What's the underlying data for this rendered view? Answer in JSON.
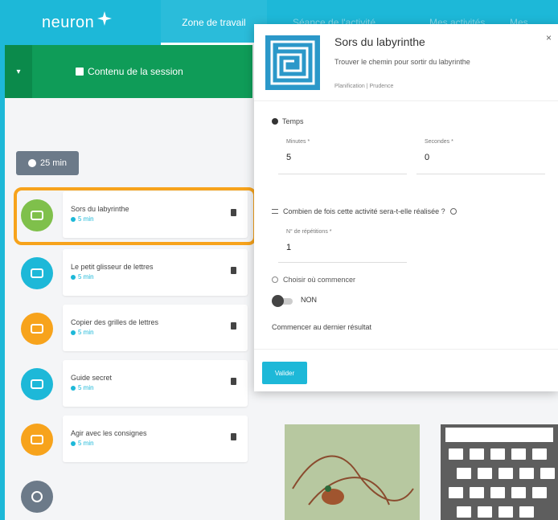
{
  "header": {
    "logo_text": "neuron",
    "tabs": [
      {
        "label": "Zone de travail",
        "active": true
      },
      {
        "label": "Séance de l'activité",
        "active": false
      },
      {
        "label": "Mes activités",
        "active": false
      },
      {
        "label": "Mes notes",
        "active": false
      }
    ],
    "accent_color": "#1db8d8"
  },
  "session": {
    "title": "Contenu de la session",
    "duration": "25 min",
    "bar_color": "#0f9c58"
  },
  "activities": [
    {
      "title": "Sors du labyrinthe",
      "sub": "5 min",
      "color": "#7fc04b"
    },
    {
      "title": "Le petit glisseur de lettres",
      "sub": "5 min",
      "color": "#1db8d8"
    },
    {
      "title": "Copier des grilles de lettres",
      "sub": "5 min",
      "color": "#f7a31c"
    },
    {
      "title": "Guide secret",
      "sub": "5 min",
      "color": "#1db8d8"
    },
    {
      "title": "Agir avec les consignes",
      "sub": "5 min",
      "color": "#f7a31c"
    }
  ],
  "modal": {
    "title": "Sors du labyrinthe",
    "description": "Trouver le chemin pour sortir du labyrinthe",
    "tag": "Planification | Prudence",
    "close": "×",
    "tempo_label": "Temps",
    "minutes_label": "Minutes *",
    "minutes_value": "5",
    "seconds_label": "Secondes *",
    "seconds_value": "0",
    "question": "Combien de fois cette activité sera-t-elle réalisée ?",
    "repeat_label": "N° de répétitions *",
    "repeat_value": "1",
    "begin_label": "Choisir où commencer",
    "toggle_text": "NON",
    "resume_text": "Commencer au dernier résultat",
    "validate_label": "Valider"
  }
}
